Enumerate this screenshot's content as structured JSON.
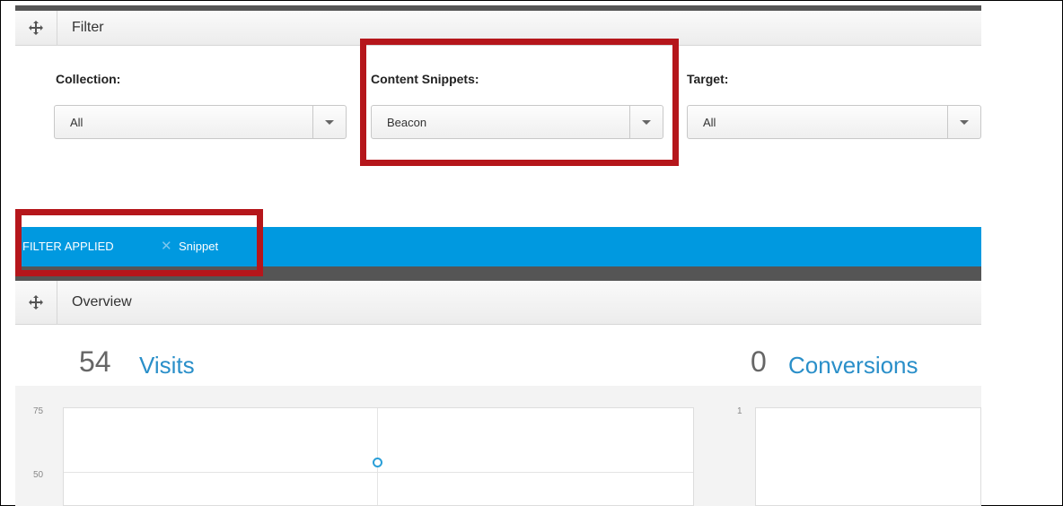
{
  "filter_panel": {
    "title": "Filter",
    "collection": {
      "label": "Collection:",
      "value": "All"
    },
    "content_snippets": {
      "label": "Content Snippets:",
      "value": "Beacon"
    },
    "target": {
      "label": "Target:",
      "value": "All"
    }
  },
  "filter_bar": {
    "applied_text": "FILTER APPLIED",
    "remove_icon": "close-icon",
    "chip_label": "Snippet",
    "color": "#0099e0"
  },
  "overview_panel": {
    "title": "Overview",
    "visits": {
      "count": "54",
      "label": "Visits"
    },
    "conversions": {
      "count": "0",
      "label": "Conversions"
    }
  },
  "chart_data": [
    {
      "type": "scatter",
      "title": "",
      "y_ticks": [
        "75",
        "50"
      ],
      "points": [
        {
          "y": 54
        }
      ]
    },
    {
      "type": "line",
      "title": "",
      "y_ticks": [
        "1"
      ]
    }
  ],
  "colors": {
    "accent": "#2a8fc9",
    "highlight_box": "#b5161b",
    "header_bar": "#555555"
  }
}
